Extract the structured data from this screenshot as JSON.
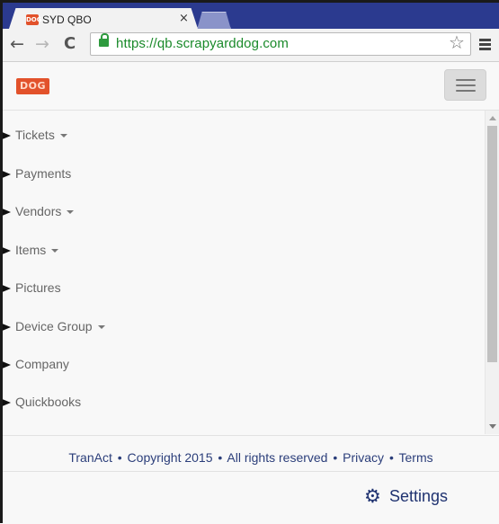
{
  "browser": {
    "tab_title": "SYD QBO",
    "tab_close": "×",
    "favicon_text": "DOG",
    "url_scheme": "https://",
    "url_host": "qb.scrapyarddog.com"
  },
  "header": {
    "logo_text": "DOG"
  },
  "nav": {
    "items": [
      {
        "label": "Tickets",
        "dropdown": true
      },
      {
        "label": "Payments",
        "dropdown": false
      },
      {
        "label": "Vendors",
        "dropdown": true
      },
      {
        "label": "Items",
        "dropdown": true
      },
      {
        "label": "Pictures",
        "dropdown": false
      },
      {
        "label": "Device Group",
        "dropdown": true
      },
      {
        "label": "Company",
        "dropdown": false
      },
      {
        "label": "Quickbooks",
        "dropdown": false
      }
    ]
  },
  "footer": {
    "tranact": "TranAct",
    "copyright": "Copyright 2015",
    "rights": "All rights reserved",
    "privacy": "Privacy",
    "terms": "Terms",
    "separator": "•",
    "settings_label": "Settings"
  },
  "colors": {
    "tab_strip": "#2b3a8f",
    "brand_orange": "#e2522b",
    "link_blue": "#2b3e7a",
    "url_green": "#1a8a2a"
  },
  "icons": [
    "favicon-icon",
    "close-icon",
    "back-icon",
    "forward-icon",
    "reload-icon",
    "lock-icon",
    "star-icon",
    "menu-icon",
    "hamburger-icon",
    "caret-down-icon",
    "gear-icon"
  ]
}
